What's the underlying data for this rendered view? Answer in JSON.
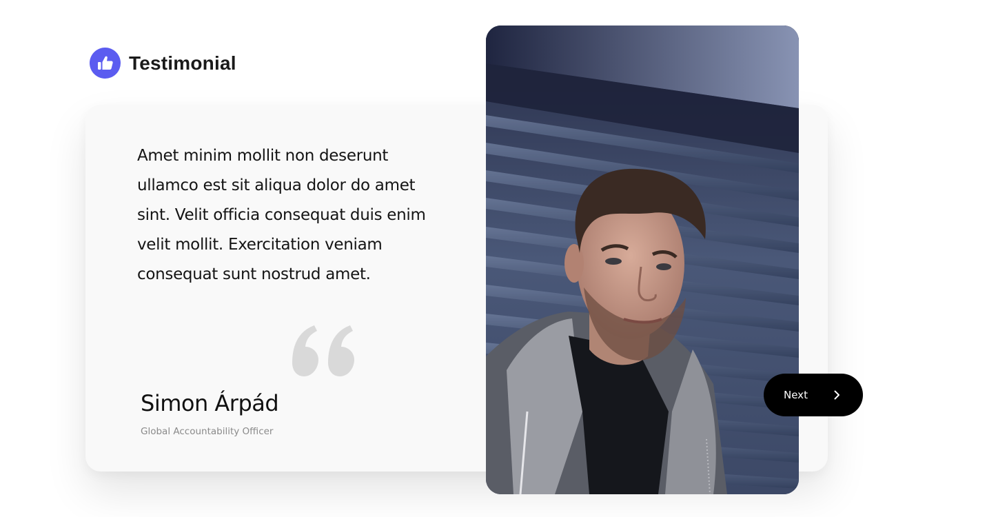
{
  "header": {
    "title": "Testimonial",
    "icon": "thumbs-up-icon"
  },
  "testimonial": {
    "quote": "Amet minim mollit non deserunt ullamco est sit aliqua dolor do amet sint. Velit officia consequat duis enim velit mollit. Exercitation veniam consequat sunt nostrud amet.",
    "author_name": "Simon Árpád",
    "author_role": "Global Accountability Officer",
    "quote_icon": "quote-mark-icon",
    "photo": "portrait-photo"
  },
  "controls": {
    "next_label": "Next",
    "next_icon": "chevron-right-icon"
  },
  "colors": {
    "accent": "#5b5cf0",
    "quote_mark": "#d9d9d9",
    "button_bg": "#000000",
    "card_bg": "#f9f9f9"
  }
}
